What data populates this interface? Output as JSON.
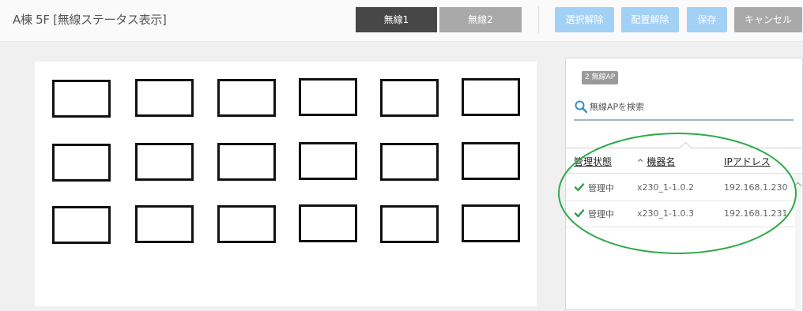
{
  "header": {
    "title": "A棟 5F [無線ステータス表示]",
    "tabs": [
      "無線1",
      "無線2"
    ],
    "buttons": {
      "deselect": "選択解除",
      "unplace": "配置解除",
      "save": "保存",
      "cancel": "キャンセル"
    }
  },
  "colors": {
    "tab_active": "#474747",
    "tab_inactive": "#a9a9a9",
    "primary_disabled": "#a3d0f5",
    "cancel": "#a9a9a9",
    "check_green": "#2e9e48",
    "annotation_green": "#2eaa4a"
  },
  "floor_plan": {
    "ap_rows": 3,
    "ap_cols": 6
  },
  "panel": {
    "badge": "2 無線AP",
    "search": {
      "placeholder": "無線APを検索",
      "icon": "search-icon"
    },
    "columns": {
      "status": "管理状態",
      "name": "機器名",
      "ip": "IPアドレス",
      "sort_icon": "^"
    },
    "rows": [
      {
        "status": "管理中",
        "name": "x230_1-1.0.2",
        "ip": "192.168.1.230",
        "icon": "check-icon"
      },
      {
        "status": "管理中",
        "name": "x230_1-1.0.3",
        "ip": "192.168.1.231",
        "icon": "check-icon"
      }
    ]
  }
}
